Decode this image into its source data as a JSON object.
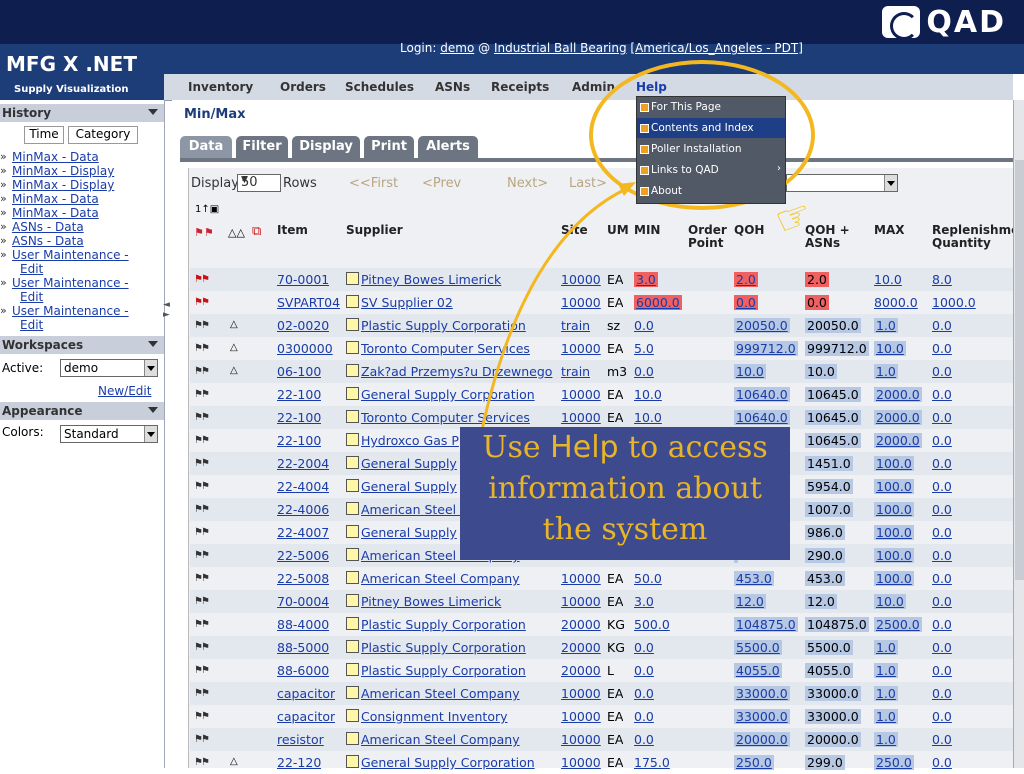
{
  "banner": {
    "brand": "QAD"
  },
  "app": {
    "logo": "MFG X .NET",
    "tagline": "Supply Visualization"
  },
  "login": {
    "prefix": "Login:",
    "user": "demo",
    "at": "@",
    "company": "Industrial Ball Bearing",
    "timezone": "[America/Los_Angeles - PDT]"
  },
  "nav": [
    "Inventory",
    "Orders",
    "Schedules",
    "ASNs",
    "Receipts",
    "Admin",
    "Help"
  ],
  "help_menu": [
    {
      "label": "For This Page",
      "active": false,
      "submenu": false
    },
    {
      "label": "Contents and Index",
      "active": true,
      "submenu": false
    },
    {
      "label": "Poller Installation",
      "active": false,
      "submenu": false
    },
    {
      "label": "Links to QAD",
      "active": false,
      "submenu": true
    },
    {
      "label": "About",
      "active": false,
      "submenu": false
    }
  ],
  "sidebar": {
    "history_title": "History",
    "toggle": [
      "Time",
      "Category"
    ],
    "history": [
      [
        "MinMax - Data"
      ],
      [
        "MinMax - Display"
      ],
      [
        "MinMax - Display"
      ],
      [
        "MinMax - Data"
      ],
      [
        "MinMax - Data"
      ],
      [
        "ASNs - Data"
      ],
      [
        "ASNs - Data"
      ],
      [
        "User Maintenance -",
        "Edit"
      ],
      [
        "User Maintenance -",
        "Edit"
      ],
      [
        "User Maintenance -",
        "Edit"
      ]
    ],
    "workspaces_title": "Workspaces",
    "active_label": "Active:",
    "active_value": "demo",
    "new_edit": "New/Edit",
    "appearance_title": "Appearance",
    "colors_label": "Colors:",
    "colors_value": "Standard"
  },
  "page": {
    "title": "Min/Max",
    "tabs": [
      "Data",
      "Filter",
      "Display",
      "Print",
      "Alerts"
    ],
    "active_tab": "Data"
  },
  "pager": {
    "display_label": "Display",
    "rows_value": "50",
    "rows_label": "Rows",
    "first": "<<First",
    "prev": "<Prev",
    "next": "Next>",
    "last": "Last>"
  },
  "table": {
    "sort_indicator": "1↑▣",
    "columns": [
      "Item",
      "Supplier",
      "Site",
      "UM",
      "MIN",
      "Order Point",
      "QOH",
      "QOH + ASNs",
      "MAX",
      "Replenishment Quantity"
    ],
    "rows": [
      {
        "flag": "red",
        "bell": false,
        "item": "70-0001",
        "supplier": "Pitney Bowes Limerick",
        "site": "10000",
        "um": "EA",
        "min": "3.0",
        "order_point": "",
        "qoh": "2.0",
        "qoh_asn": "2.0",
        "max": "10.0",
        "repl": "8.0",
        "alert": true
      },
      {
        "flag": "red",
        "bell": false,
        "item": "SVPART04",
        "supplier": "SV Supplier 02",
        "site": "10000",
        "um": "EA",
        "min": "6000.0",
        "order_point": "",
        "qoh": "0.0",
        "qoh_asn": "0.0",
        "max": "8000.0",
        "repl": "1000.0",
        "alert": true
      },
      {
        "flag": "gray",
        "bell": true,
        "item": "02-0020",
        "supplier": "Plastic Supply Corporation",
        "site": "train",
        "um": "sz",
        "min": "0.0",
        "order_point": "",
        "qoh": "20050.0",
        "qoh_asn": "20050.0",
        "max": "1.0",
        "repl": "0.0"
      },
      {
        "flag": "gray",
        "bell": true,
        "item": "0300000",
        "supplier": "Toronto Computer Services",
        "site": "10000",
        "um": "EA",
        "min": "5.0",
        "order_point": "",
        "qoh": "999712.0",
        "qoh_asn": "999712.0",
        "max": "10.0",
        "repl": "0.0"
      },
      {
        "flag": "gray",
        "bell": true,
        "item": "06-100",
        "supplier": "Zak?ad Przemys?u Drzewnego",
        "site": "train",
        "um": "m3",
        "min": "0.0",
        "order_point": "",
        "qoh": "10.0",
        "qoh_asn": "10.0",
        "max": "1.0",
        "repl": "0.0"
      },
      {
        "flag": "gray",
        "bell": false,
        "item": "22-100",
        "supplier": "General Supply Corporation",
        "site": "10000",
        "um": "EA",
        "min": "10.0",
        "order_point": "",
        "qoh": "10640.0",
        "qoh_asn": "10645.0",
        "max": "2000.0",
        "repl": "0.0"
      },
      {
        "flag": "gray",
        "bell": false,
        "item": "22-100",
        "supplier": "Toronto Computer Services",
        "site": "10000",
        "um": "EA",
        "min": "10.0",
        "order_point": "",
        "qoh": "10640.0",
        "qoh_asn": "10645.0",
        "max": "2000.0",
        "repl": "0.0"
      },
      {
        "flag": "gray",
        "bell": false,
        "item": "22-100",
        "supplier": "Hydroxco Gas P",
        "site": "",
        "um": "",
        "min": "",
        "order_point": "",
        "qoh": "",
        "qoh_asn": "10645.0",
        "max": "2000.0",
        "repl": "0.0"
      },
      {
        "flag": "gray",
        "bell": false,
        "item": "22-2004",
        "supplier": "General Supply",
        "site": "",
        "um": "",
        "min": "",
        "order_point": "",
        "qoh": "",
        "qoh_asn": "1451.0",
        "max": "100.0",
        "repl": "0.0"
      },
      {
        "flag": "gray",
        "bell": false,
        "item": "22-4004",
        "supplier": "General Supply",
        "site": "",
        "um": "",
        "min": "",
        "order_point": "",
        "qoh": "",
        "qoh_asn": "5954.0",
        "max": "100.0",
        "repl": "0.0"
      },
      {
        "flag": "gray",
        "bell": false,
        "item": "22-4006",
        "supplier": "American Steel C",
        "site": "",
        "um": "",
        "min": "",
        "order_point": "",
        "qoh": "",
        "qoh_asn": "1007.0",
        "max": "100.0",
        "repl": "0.0"
      },
      {
        "flag": "gray",
        "bell": false,
        "item": "22-4007",
        "supplier": "General Supply",
        "site": "",
        "um": "",
        "min": "",
        "order_point": "",
        "qoh": "",
        "qoh_asn": "986.0",
        "max": "100.0",
        "repl": "0.0"
      },
      {
        "flag": "gray",
        "bell": false,
        "item": "22-5006",
        "supplier": "American Steel Company",
        "site": "",
        "um": "",
        "min": "",
        "order_point": "",
        "qoh": "",
        "qoh_asn": "290.0",
        "max": "100.0",
        "repl": "0.0"
      },
      {
        "flag": "gray",
        "bell": false,
        "item": "22-5008",
        "supplier": "American Steel Company",
        "site": "10000",
        "um": "EA",
        "min": "50.0",
        "order_point": "",
        "qoh": "453.0",
        "qoh_asn": "453.0",
        "max": "100.0",
        "repl": "0.0"
      },
      {
        "flag": "gray",
        "bell": false,
        "item": "70-0004",
        "supplier": "Pitney Bowes Limerick",
        "site": "10000",
        "um": "EA",
        "min": "3.0",
        "order_point": "",
        "qoh": "12.0",
        "qoh_asn": "12.0",
        "max": "10.0",
        "repl": "0.0"
      },
      {
        "flag": "gray",
        "bell": false,
        "item": "88-4000",
        "supplier": "Plastic Supply Corporation",
        "site": "20000",
        "um": "KG",
        "min": "500.0",
        "order_point": "",
        "qoh": "104875.0",
        "qoh_asn": "104875.0",
        "max": "2500.0",
        "repl": "0.0"
      },
      {
        "flag": "gray",
        "bell": false,
        "item": "88-5000",
        "supplier": "Plastic Supply Corporation",
        "site": "20000",
        "um": "KG",
        "min": "0.0",
        "order_point": "",
        "qoh": "5500.0",
        "qoh_asn": "5500.0",
        "max": "1.0",
        "repl": "0.0"
      },
      {
        "flag": "gray",
        "bell": false,
        "item": "88-6000",
        "supplier": "Plastic Supply Corporation",
        "site": "20000",
        "um": "L",
        "min": "0.0",
        "order_point": "",
        "qoh": "4055.0",
        "qoh_asn": "4055.0",
        "max": "1.0",
        "repl": "0.0"
      },
      {
        "flag": "gray",
        "bell": false,
        "item": "capacitor",
        "supplier": "American Steel Company",
        "site": "10000",
        "um": "EA",
        "min": "0.0",
        "order_point": "",
        "qoh": "33000.0",
        "qoh_asn": "33000.0",
        "max": "1.0",
        "repl": "0.0"
      },
      {
        "flag": "gray",
        "bell": false,
        "item": "capacitor",
        "supplier": "Consignment Inventory",
        "site": "10000",
        "um": "EA",
        "min": "0.0",
        "order_point": "",
        "qoh": "33000.0",
        "qoh_asn": "33000.0",
        "max": "1.0",
        "repl": "0.0"
      },
      {
        "flag": "gray",
        "bell": false,
        "item": "resistor",
        "supplier": "American Steel Company",
        "site": "10000",
        "um": "EA",
        "min": "0.0",
        "order_point": "",
        "qoh": "20000.0",
        "qoh_asn": "20000.0",
        "max": "1.0",
        "repl": "0.0"
      },
      {
        "flag": "gray",
        "bell": true,
        "item": "22-120",
        "supplier": "General Supply Corporation",
        "site": "10000",
        "um": "EA",
        "min": "175.0",
        "order_point": "",
        "qoh": "250.0",
        "qoh_asn": "299.0",
        "max": "250.0",
        "repl": "0.0"
      }
    ]
  },
  "callout": {
    "pre": "Use",
    "help_word": "Help",
    "post": "to access information about the system"
  },
  "colors": {
    "banner": "#0d1e4f",
    "header": "#1d3d78",
    "accent": "#f3b820",
    "callout_bg": "#3e4a8e",
    "alert": "#f06060",
    "link": "#1a3ca8"
  }
}
